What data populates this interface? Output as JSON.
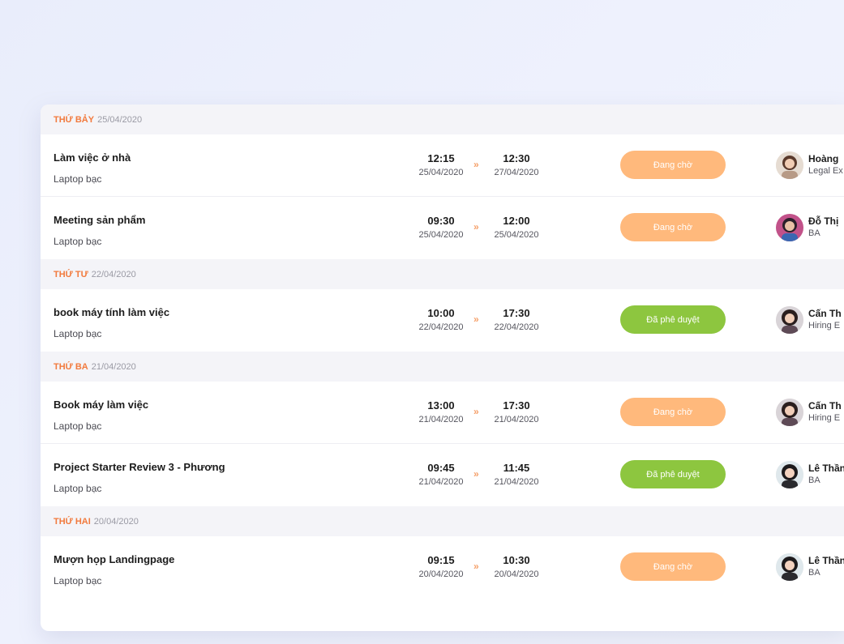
{
  "groups": [
    {
      "day": "Thứ Bảy",
      "date": "25/04/2020",
      "rows": [
        {
          "title": "Làm việc ở nhà",
          "device": "Laptop bạc",
          "start_time": "12:15",
          "start_date": "25/04/2020",
          "end_time": "12:30",
          "end_date": "27/04/2020",
          "status": "Đang chờ",
          "person_name": "Hoàng",
          "person_role": "Legal Ex"
        },
        {
          "title": "Meeting sản phẩm",
          "device": "Laptop bạc",
          "start_time": "09:30",
          "start_date": "25/04/2020",
          "end_time": "12:00",
          "end_date": "25/04/2020",
          "status": "Đang chờ",
          "person_name": "Đỗ Thị",
          "person_role": "BA"
        }
      ]
    },
    {
      "day": "Thứ Tư",
      "date": "22/04/2020",
      "rows": [
        {
          "title": "book máy tính làm việc",
          "device": "Laptop bạc",
          "start_time": "10:00",
          "start_date": "22/04/2020",
          "end_time": "17:30",
          "end_date": "22/04/2020",
          "status": "Đã phê duyệt",
          "person_name": "Cấn Th",
          "person_role": "Hiring E"
        }
      ]
    },
    {
      "day": "Thứ Ba",
      "date": "21/04/2020",
      "rows": [
        {
          "title": "Book máy làm việc",
          "device": "Laptop bạc",
          "start_time": "13:00",
          "start_date": "21/04/2020",
          "end_time": "17:30",
          "end_date": "21/04/2020",
          "status": "Đang chờ",
          "person_name": "Cấn Th",
          "person_role": "Hiring E"
        },
        {
          "title": "Project Starter Review 3 - Phương",
          "device": "Laptop bạc",
          "start_time": "09:45",
          "start_date": "21/04/2020",
          "end_time": "11:45",
          "end_date": "21/04/2020",
          "status": "Đã phê duyệt",
          "person_name": "Lê Thần",
          "person_role": "BA"
        }
      ]
    },
    {
      "day": "Thứ Hai",
      "date": "20/04/2020",
      "rows": [
        {
          "title": "Mượn họp Landingpage",
          "device": "Laptop bạc",
          "start_time": "09:15",
          "start_date": "20/04/2020",
          "end_time": "10:30",
          "end_date": "20/04/2020",
          "status": "Đang chờ",
          "person_name": "Lê Thần",
          "person_role": "BA"
        }
      ]
    }
  ],
  "arrow_glyph": "»",
  "colors": {
    "day_accent": "#f27a3d",
    "pending": "#ffb97c",
    "approved": "#8dc63f"
  }
}
